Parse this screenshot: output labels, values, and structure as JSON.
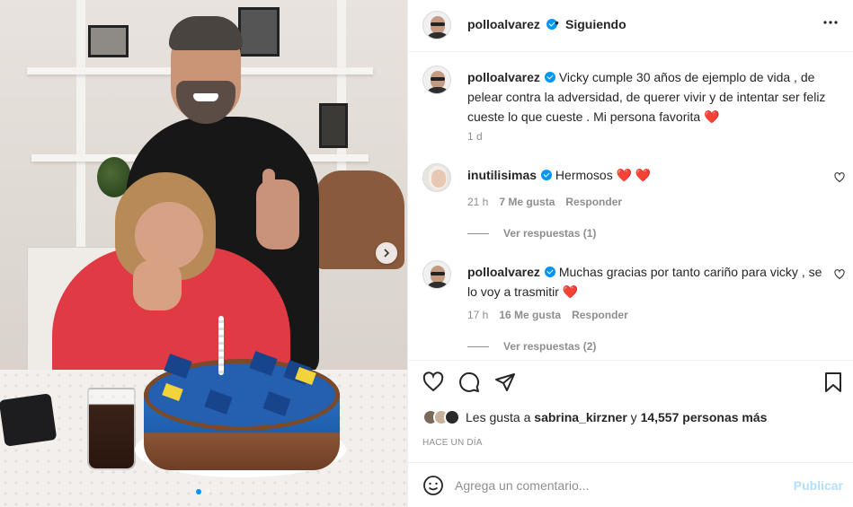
{
  "post": {
    "photo_alt": "Post photo",
    "carousel_dots": 2,
    "active_dot": 0
  },
  "header": {
    "username": "polloalvarez",
    "separator": "•",
    "follow_status": "Siguiendo",
    "more_icon": "more-horizontal-icon"
  },
  "caption": {
    "username": "polloalvarez",
    "text": "Vicky cumple 30 años de ejemplo de vida , de pelear contra la adversidad, de querer vivir y de intentar ser feliz cueste lo que cueste . Mi persona favorita",
    "emoji": "❤️",
    "time": "1 d"
  },
  "comments": [
    {
      "username": "inutilisimas",
      "text": "Hermosos",
      "emoji": "❤️ ❤️",
      "time": "21 h",
      "likes": "7 Me gusta",
      "reply": "Responder",
      "view_replies": "Ver respuestas (1)"
    },
    {
      "username": "polloalvarez",
      "text": "Muchas gracias por tanto cariño para vicky , se lo voy a trasmitir",
      "emoji": "❤️",
      "time": "17 h",
      "likes": "16 Me gusta",
      "reply": "Responder",
      "view_replies": "Ver respuestas (2)"
    }
  ],
  "likes": {
    "prefix": "Les gusta a",
    "user": "sabrina_kirzner",
    "middle": "y",
    "count": "14,557 personas más"
  },
  "time_ago": "HACE UN DÍA",
  "add_comment": {
    "placeholder": "Agrega un comentario...",
    "publish": "Publicar"
  },
  "colors": {
    "accent": "#0095f6",
    "publish_disabled": "#b2dffc",
    "heart": "#ed4956",
    "muted": "#8e8e8e",
    "text": "#262626"
  }
}
